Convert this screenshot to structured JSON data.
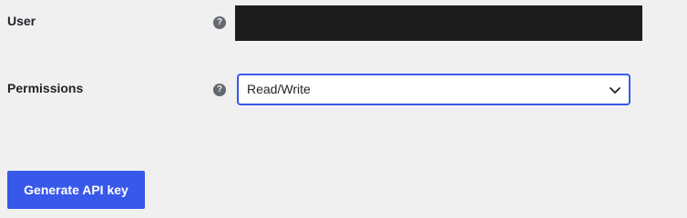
{
  "form": {
    "user": {
      "label": "User",
      "help": "?",
      "value": ""
    },
    "permissions": {
      "label": "Permissions",
      "help": "?",
      "selected": "Read/Write"
    },
    "submit_label": "Generate API key"
  },
  "colors": {
    "accent": "#3858e9",
    "background": "#f0f0f1",
    "redacted_field": "#1d1d1d"
  },
  "icons": {
    "help": "question-circle-icon",
    "select_arrow": "chevron-down-icon"
  }
}
